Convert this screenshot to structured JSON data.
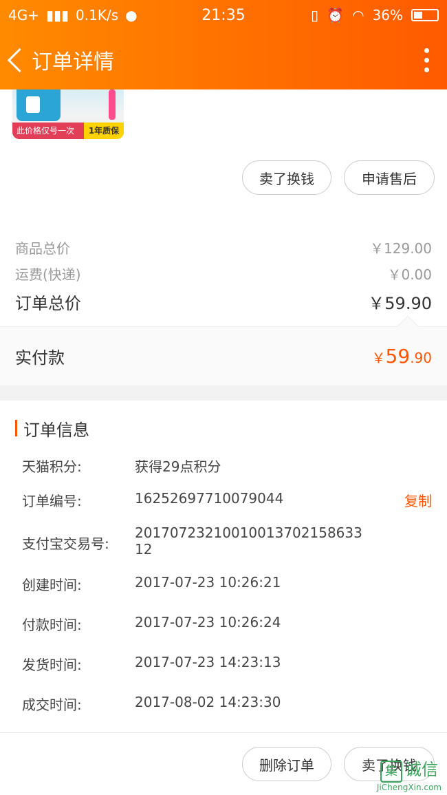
{
  "statusbar": {
    "network": "4G+",
    "speed": "0.1K/s",
    "time": "21:35",
    "battery": "36%"
  },
  "navbar": {
    "title": "订单详情"
  },
  "product": {
    "promo_left": "此价格仅号一次",
    "promo_right": "1年质保"
  },
  "actions_top": {
    "sell_label": "卖了换钱",
    "aftersale_label": "申请售后"
  },
  "summary": {
    "goods_total_label": "商品总价",
    "goods_total_value": "￥129.00",
    "shipping_label": "运费(快递)",
    "shipping_value": "￥0.00",
    "order_total_label": "订单总价",
    "order_total_value": "￥59.90"
  },
  "paid": {
    "label": "实付款",
    "currency": "￥",
    "int": "59",
    "dec": ".90"
  },
  "order_info": {
    "title": "订单信息",
    "copy_label": "复制",
    "rows": [
      {
        "k": "天猫积分:",
        "v": "获得29点积分"
      },
      {
        "k": "订单编号:",
        "v": "16252697710079044"
      },
      {
        "k": "支付宝交易号:",
        "v": "2017072321001001370215863312"
      },
      {
        "k": "创建时间:",
        "v": "2017-07-23 10:26:21"
      },
      {
        "k": "付款时间:",
        "v": "2017-07-23 10:26:24"
      },
      {
        "k": "发货时间:",
        "v": "2017-07-23 14:23:13"
      },
      {
        "k": "成交时间:",
        "v": "2017-08-02 14:23:30"
      }
    ]
  },
  "actions_bottom": {
    "delete_label": "删除订单",
    "sell_label": "卖了换钱"
  },
  "watermark": {
    "logo": "集",
    "text": "诚信",
    "url": "JiChengXin.com"
  }
}
